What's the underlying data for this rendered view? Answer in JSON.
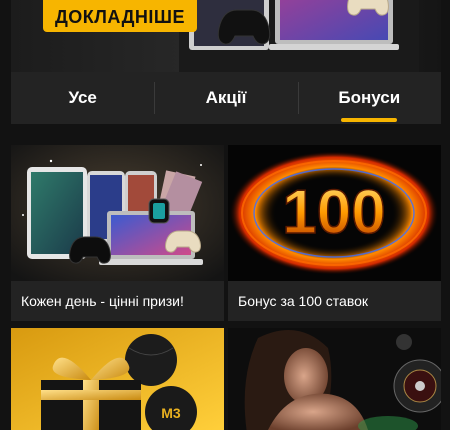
{
  "hero": {
    "button_label": "ДОКЛАДНІШЕ"
  },
  "tabs": [
    {
      "label": "Усе"
    },
    {
      "label": "Акції"
    },
    {
      "label": "Бонуси"
    }
  ],
  "active_tab": "Бонуси",
  "cards": [
    {
      "title": "Кожен день - цінні призи!"
    },
    {
      "title": "Бонус за 100 ставок",
      "art_number": "100"
    },
    {
      "title": "",
      "art_badge": "M3"
    },
    {
      "title": ""
    }
  ],
  "colors": {
    "accent": "#f7b500",
    "background": "#121212",
    "card": "#232323"
  }
}
